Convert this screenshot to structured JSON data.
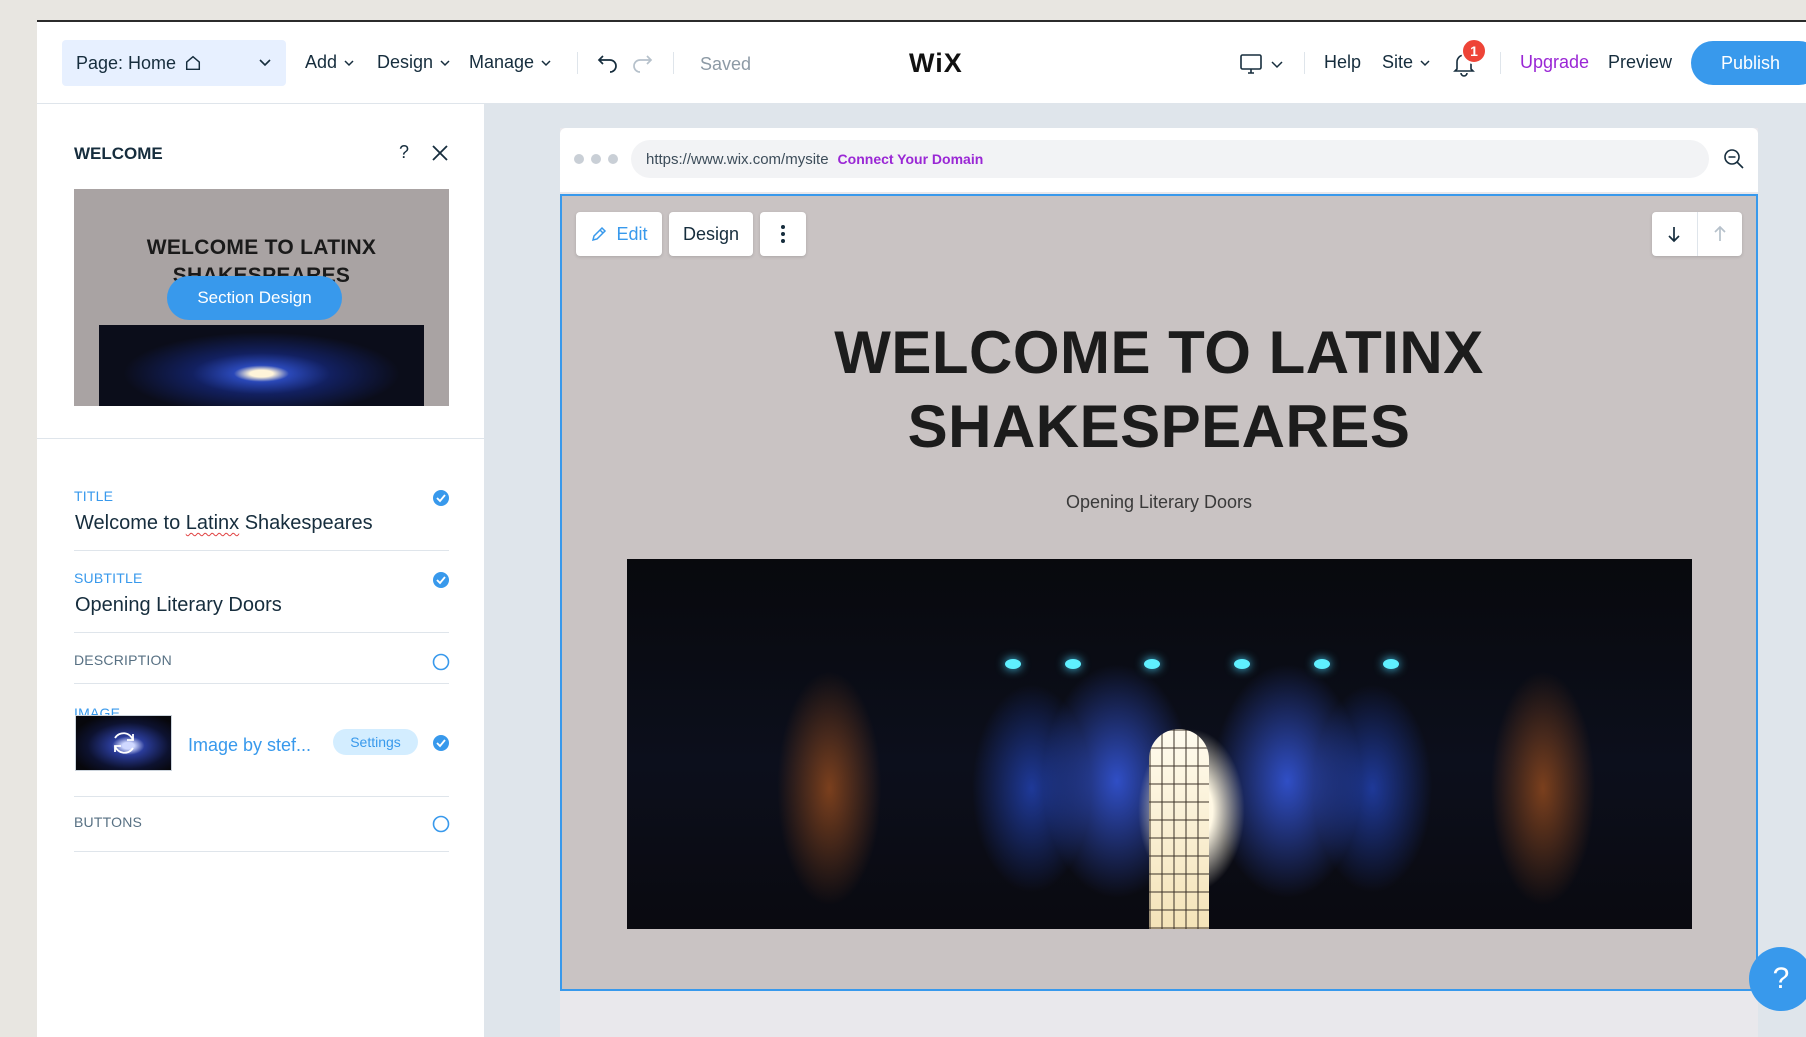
{
  "topbar": {
    "page_select_label": "Page: Home",
    "menu": [
      {
        "label": "Add"
      },
      {
        "label": "Design"
      },
      {
        "label": "Manage"
      }
    ],
    "saved_status": "Saved",
    "logo": "WiX",
    "help_label": "Help",
    "site_label": "Site",
    "notification_count": "1",
    "upgrade_label": "Upgrade",
    "preview_label": "Preview",
    "publish_label": "Publish"
  },
  "panel": {
    "title": "WELCOME",
    "help_glyph": "?",
    "thumbnail": {
      "title": "WELCOME TO LATINX SHAKESPEARES",
      "button_label": "Section Design"
    },
    "fields": {
      "title_label": "TITLE",
      "title_value_prefix": "Welcome to ",
      "title_value_misspelled": "Latinx",
      "title_value_suffix": " Shakespeares",
      "subtitle_label": "SUBTITLE",
      "subtitle_value": "Opening Literary Doors",
      "description_label": "DESCRIPTION",
      "image_label": "IMAGE",
      "image_name": "Image by stef...",
      "image_settings_label": "Settings",
      "buttons_label": "BUTTONS"
    }
  },
  "browser": {
    "url": "https://www.wix.com/mysite",
    "connect_domain": "Connect Your Domain"
  },
  "section": {
    "edit_label": "Edit",
    "design_label": "Design",
    "hero_title_line1": "WELCOME TO LATINX",
    "hero_title_line2": "SHAKESPEARES",
    "hero_subtitle": "Opening Literary Doors"
  },
  "help_fab_glyph": "?",
  "colors": {
    "accent": "#3899ec",
    "upgrade": "#9a27d5",
    "badge": "#ee4437",
    "section_bg": "#c9c3c3"
  }
}
